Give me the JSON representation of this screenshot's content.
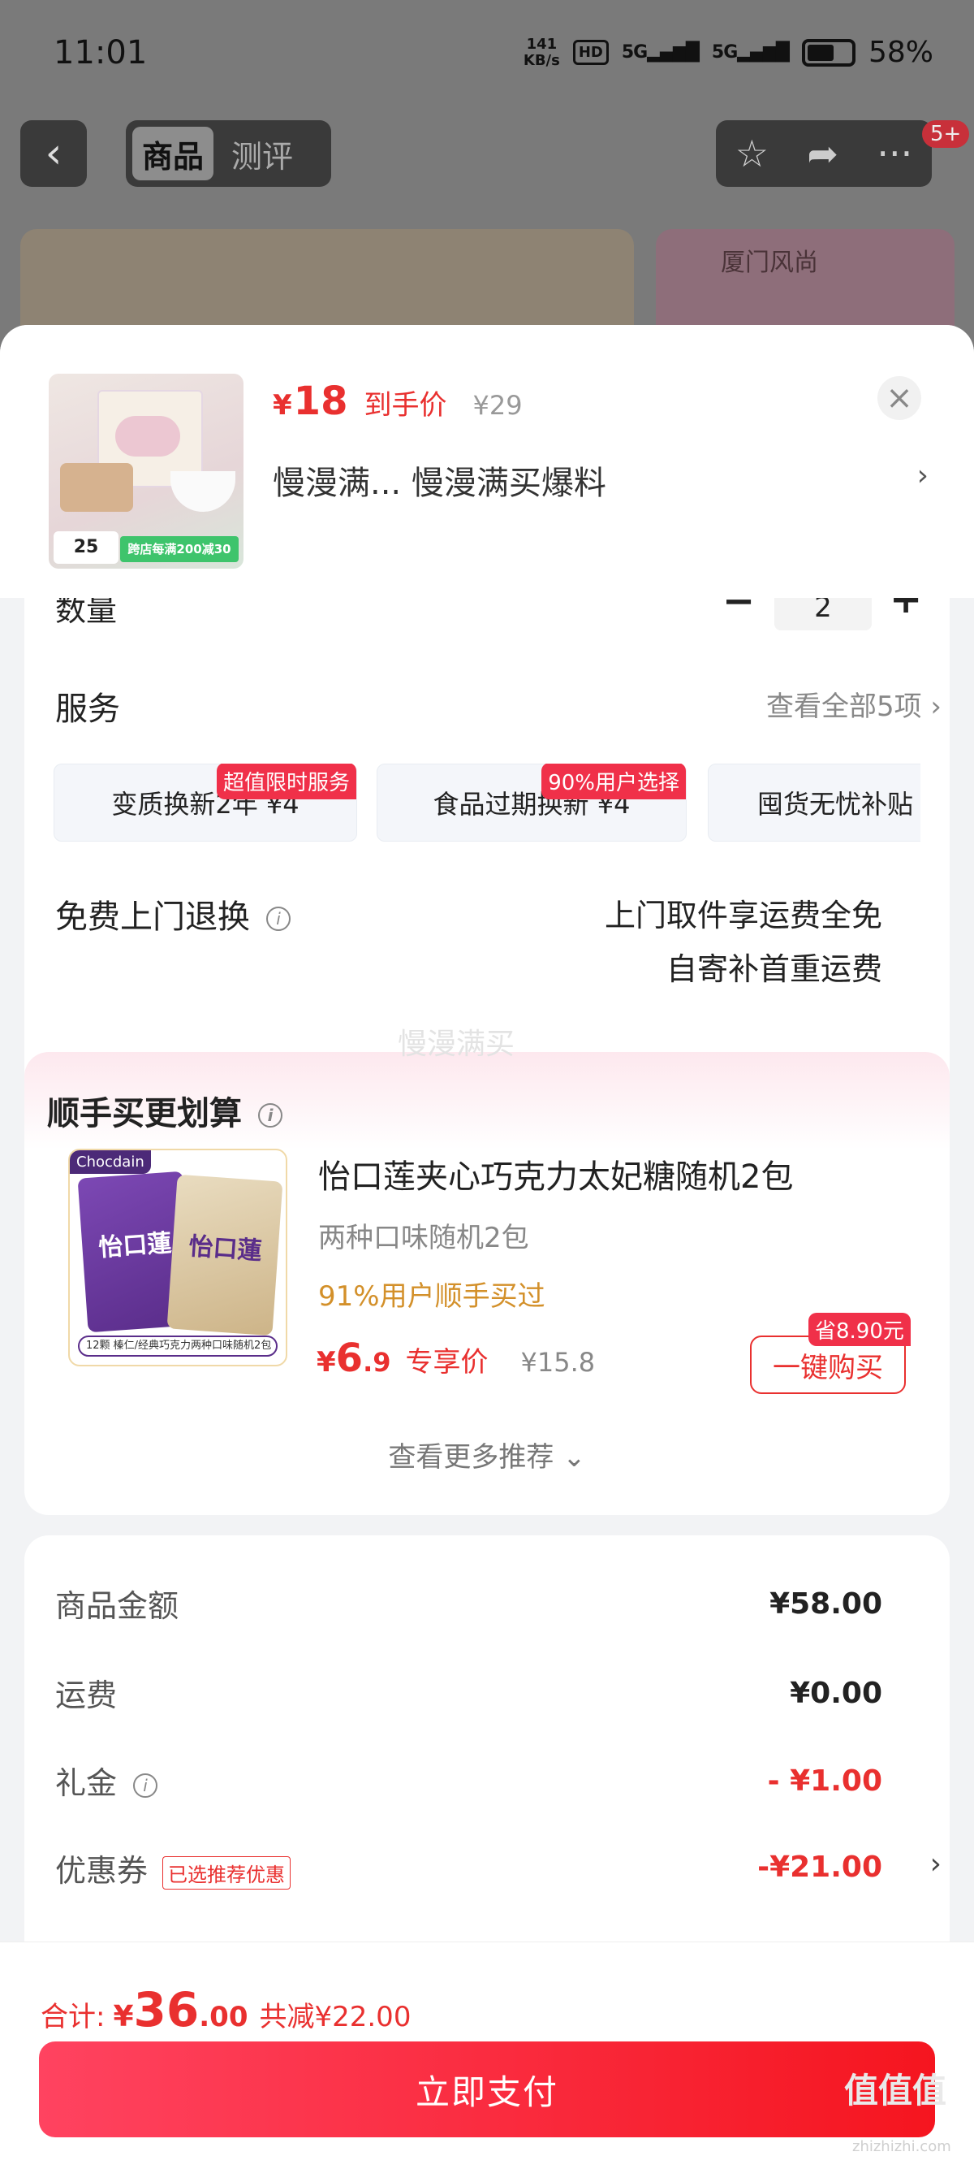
{
  "status": {
    "time": "11:01",
    "net_speed": "141",
    "net_unit": "KB/s",
    "hd": "HD",
    "sig1": "5G",
    "sig2": "5G",
    "battery": "58%"
  },
  "topbar": {
    "back_icon": "‹",
    "tabs": [
      {
        "label": "商品"
      },
      {
        "label": "测评"
      }
    ],
    "star_icon": "☆",
    "share_icon": "➦",
    "more_icon": "···",
    "badge": "5+"
  },
  "banner_right_title": "厦门风尚",
  "sku": {
    "thumb_date": "25",
    "thumb_promo": "跨店每满200减30",
    "price_symbol": "¥",
    "price": "18",
    "price_label": "到手价",
    "original_price": "¥29",
    "spec": "慢漫满...  慢漫满买爆料",
    "close_icon": "×"
  },
  "quantity": {
    "label": "数量",
    "value": "2",
    "minus": "−",
    "plus": "+"
  },
  "service": {
    "title": "服务",
    "view_all": "查看全部5项 ›",
    "chips": [
      {
        "label": "变质换新2年  ¥4",
        "tag": "超值限时服务"
      },
      {
        "label": "食品过期换新  ¥4",
        "tag": "90%用户选择"
      },
      {
        "label": "囤货无忧补贴",
        "tag": ""
      }
    ]
  },
  "return": {
    "title": "免费上门退换",
    "line1": "上门取件享运费全免",
    "line2": "自寄补首重运费"
  },
  "watermark_text": "慢漫满买",
  "recommend": {
    "title": "顺手买更划算",
    "brand": "怡口蓮",
    "corner": "Chocdain",
    "strip": "12颗 榛仁/经典巧克力两种口味随机2包",
    "name": "怡口莲夹心巧克力太妃糖随机2包",
    "sub": "两种口味随机2包",
    "social": "91%用户顺手买过",
    "price_symbol": "¥",
    "price_int": "6",
    "price_dec": ".9",
    "price_label": "专享价",
    "original_price": "¥15.8",
    "save_tag": "省8.90元",
    "buy_label": "一键购买",
    "more": "查看更多推荐 ⌄"
  },
  "summary": {
    "items": [
      {
        "label": "商品金额",
        "value": "¥58.00"
      },
      {
        "label": "运费",
        "value": "¥0.00"
      },
      {
        "label": "礼金",
        "value": "- ¥1.00"
      },
      {
        "label": "优惠券",
        "value": "-¥21.00"
      }
    ],
    "coupon_tag": "已选推荐优惠"
  },
  "footer": {
    "total_label": "合计:",
    "total_symbol": "¥",
    "total_int": "36",
    "total_dec": ".00",
    "saved": "共减¥22.00",
    "pay_label": "立即支付",
    "wm_brand": "值值值",
    "wm_url": "zhizhizhi.com"
  },
  "colors": {
    "accent": "#e9302f",
    "pay_start": "#ff4360",
    "pay_end": "#f5151f",
    "social": "#d3902a"
  }
}
